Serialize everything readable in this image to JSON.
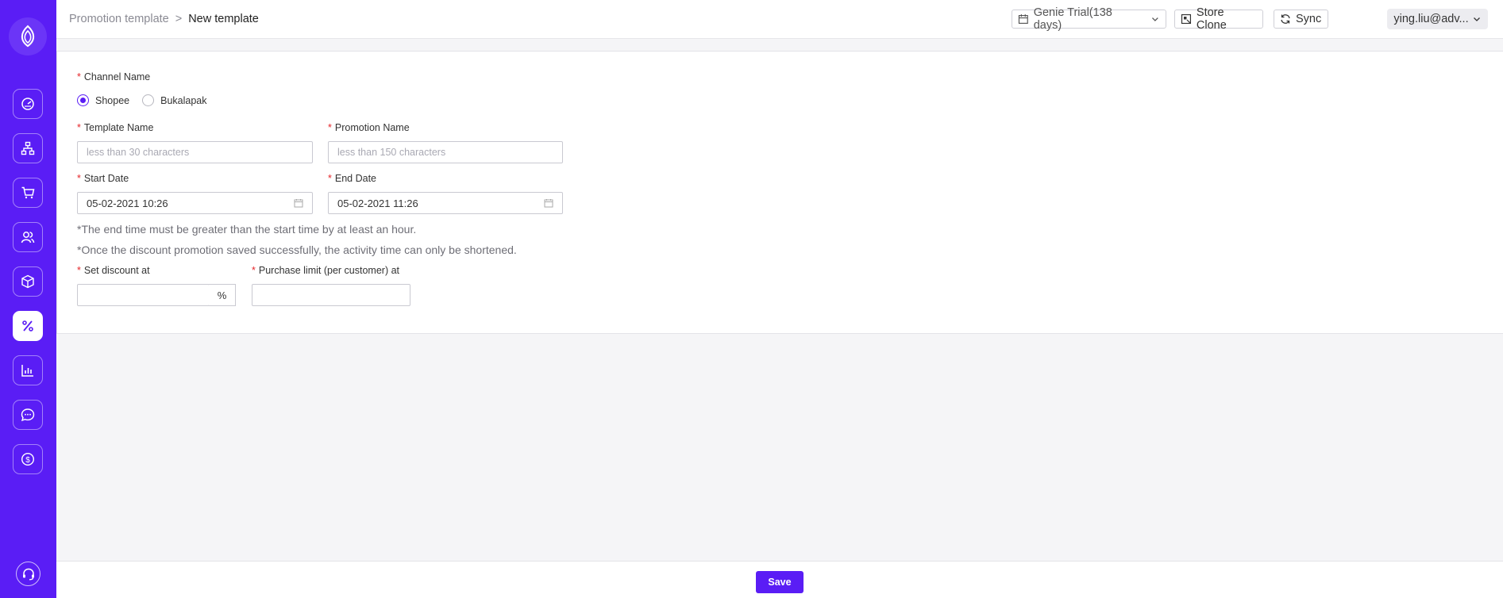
{
  "header": {
    "breadcrumb": {
      "parent": "Promotion template",
      "separator": ">",
      "current": "New template"
    },
    "plan_label": "Genie Trial(138 days)",
    "store_clone_label": "Store Clone",
    "sync_label": "Sync",
    "user_label": "ying.liu@adv..."
  },
  "sidebar": {
    "items": [
      {
        "icon": "dashboard-icon",
        "active": false
      },
      {
        "icon": "hierarchy-icon",
        "active": false
      },
      {
        "icon": "cart-icon",
        "active": false
      },
      {
        "icon": "users-icon",
        "active": false
      },
      {
        "icon": "box-icon",
        "active": false
      },
      {
        "icon": "percent-icon",
        "active": true
      },
      {
        "icon": "chart-icon",
        "active": false
      },
      {
        "icon": "chat-icon",
        "active": false
      },
      {
        "icon": "dollar-icon",
        "active": false
      }
    ],
    "support_icon": "headset-icon"
  },
  "form": {
    "channel": {
      "label": "Channel Name",
      "options": [
        "Shopee",
        "Bukalapak"
      ],
      "selected": "Shopee"
    },
    "template_name": {
      "label": "Template Name",
      "value": "",
      "placeholder": "less than 30 characters"
    },
    "promotion_name": {
      "label": "Promotion Name",
      "value": "",
      "placeholder": "less than 150 characters"
    },
    "start_date": {
      "label": "Start Date",
      "value": "05-02-2021 10:26"
    },
    "end_date": {
      "label": "End Date",
      "value": "05-02-2021 11:26"
    },
    "notes": [
      "*The end time must be greater than the start time by at least an hour.",
      "*Once the discount promotion saved successfully, the activity time can only be shortened."
    ],
    "discount": {
      "label": "Set discount at",
      "value": "",
      "unit": "%"
    },
    "purchase_limit": {
      "label": "Purchase limit (per customer) at",
      "value": ""
    }
  },
  "footer": {
    "save_label": "Save"
  },
  "colors": {
    "brand": "#5a1df5",
    "required": "#e5262a"
  }
}
